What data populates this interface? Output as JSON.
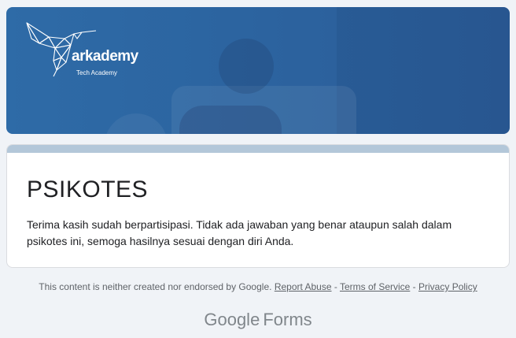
{
  "header": {
    "logo_name": "arkademy",
    "logo_tagline": "Tech Academy"
  },
  "form": {
    "title": "PSIKOTES",
    "description": "Terima kasih sudah berpartisipasi. Tidak ada jawaban yang benar ataupun salah dalam psikotes ini, semoga hasilnya sesuai dengan diri Anda."
  },
  "footer": {
    "disclaimer": "This content is neither created nor endorsed by Google.",
    "report_abuse": "Report Abuse",
    "sep1": " - ",
    "terms": "Terms of Service",
    "sep2": " - ",
    "privacy": "Privacy Policy"
  },
  "brand": {
    "google": "Google",
    "forms": "Forms"
  },
  "colors": {
    "banner": "#2c64a0",
    "card_accent": "#b3c7d9",
    "background": "#f0f3f7"
  }
}
